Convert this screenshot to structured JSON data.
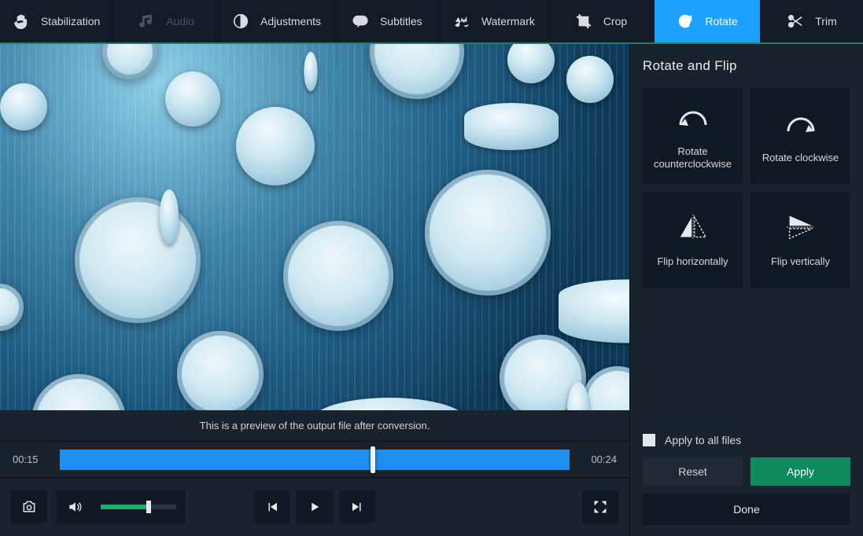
{
  "tabs": {
    "stabilization": "Stabilization",
    "audio": "Audio",
    "adjustments": "Adjustments",
    "subtitles": "Subtitles",
    "watermark": "Watermark",
    "crop": "Crop",
    "rotate": "Rotate",
    "trim": "Trim"
  },
  "preview": {
    "caption": "This is a preview of the output file after conversion.",
    "current_time": "00:15",
    "total_time": "00:24"
  },
  "panel": {
    "title": "Rotate and Flip",
    "tiles": {
      "rotate_ccw": "Rotate counterclockwise",
      "rotate_cw": "Rotate clockwise",
      "flip_h": "Flip horizontally",
      "flip_v": "Flip vertically"
    },
    "apply_all": "Apply to all files",
    "reset": "Reset",
    "apply": "Apply",
    "done": "Done"
  }
}
